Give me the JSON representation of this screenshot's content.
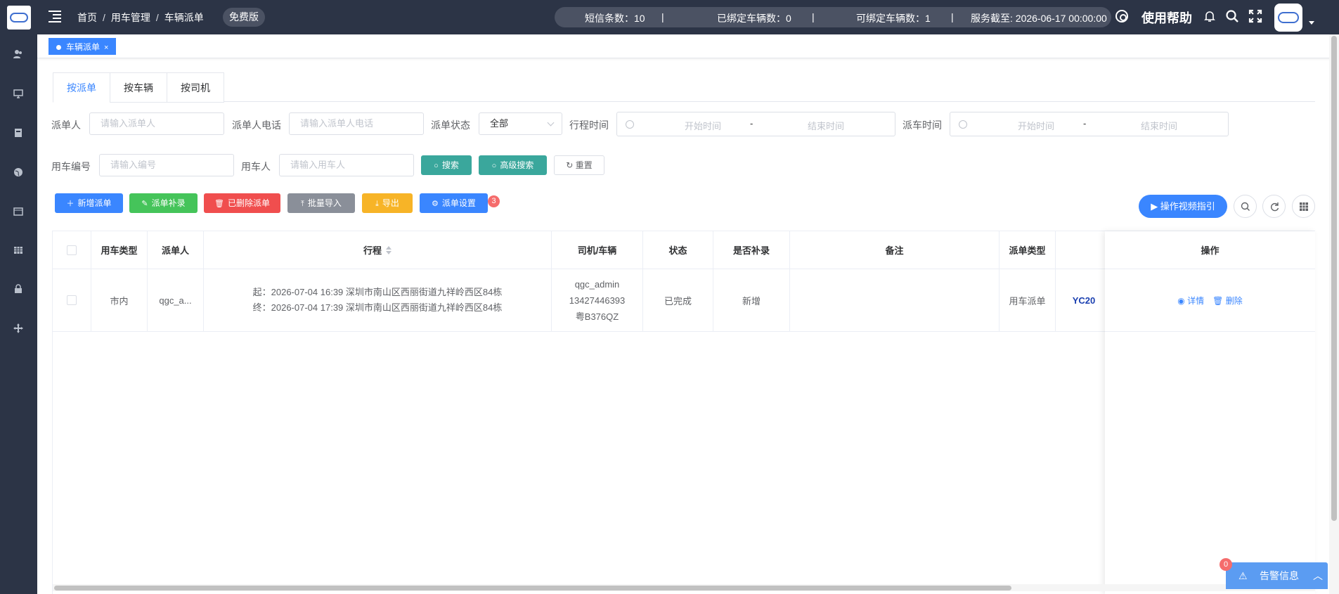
{
  "topbar": {
    "breadcrumb": [
      "首页",
      "用车管理",
      "车辆派单"
    ],
    "free_badge": "免费版",
    "sms_count": "短信条数：10",
    "bound_vehicles": "已绑定车辆数：0",
    "bindable_vehicles": "可绑定车辆数：1",
    "service_until": "服务截至: 2026-06-17 00:00:00",
    "help": "使用帮助"
  },
  "tags": {
    "active": "车辆派单",
    "close": "×"
  },
  "tabs": [
    "按派单",
    "按车辆",
    "按司机"
  ],
  "filters": {
    "dispatcher_label": "派单人",
    "dispatcher_placeholder": "请输入派单人",
    "phone_label": "派单人电话",
    "phone_placeholder": "请输入派单人电话",
    "status_label": "派单状态",
    "status_value": "全部",
    "trip_time_label": "行程时间",
    "start_placeholder": "开始时间",
    "end_placeholder": "结束时间",
    "range_sep": "-",
    "dispatch_time_label": "派车时间",
    "code_label": "用车编号",
    "code_placeholder": "请输入编号",
    "user_label": "用车人",
    "user_placeholder": "请输入用车人",
    "search": "搜索",
    "advanced": "高级搜索",
    "reset": "重置"
  },
  "actions": {
    "add": "新增派单",
    "supplement": "派单补录",
    "deleted": "已删除派单",
    "import": "批量导入",
    "export": "导出",
    "settings": "派单设置",
    "settings_badge": "3",
    "video": "操作视频指引"
  },
  "table": {
    "headers": [
      "用车类型",
      "派单人",
      "行程",
      "司机/车辆",
      "状态",
      "是否补录",
      "备注",
      "派单类型",
      "操作"
    ],
    "rows": [
      {
        "type": "市内",
        "dispatcher": "qgc_a...",
        "trip_start": "起：2026-07-04 16:39 深圳市南山区西丽街道九祥岭西区84栋",
        "trip_end": "终：2026-07-04 17:39 深圳市南山区西丽街道九祥岭西区84栋",
        "driver": "qgc_admin",
        "phone": "13427446393",
        "plate": "粤B376QZ",
        "status": "已完成",
        "supplement": "新增",
        "remark": "",
        "order_type": "用车派单",
        "code": "YC20",
        "detail": "详情",
        "delete": "删除"
      }
    ]
  },
  "alarm": {
    "label": "告警信息",
    "badge": "0"
  },
  "colors": {
    "primary": "#3a86ff",
    "sidebar": "#2c3446",
    "teal": "#3aa79c",
    "green": "#45c45a",
    "red": "#f04e4e",
    "gray": "#8a8f99",
    "orange": "#f7b427"
  }
}
